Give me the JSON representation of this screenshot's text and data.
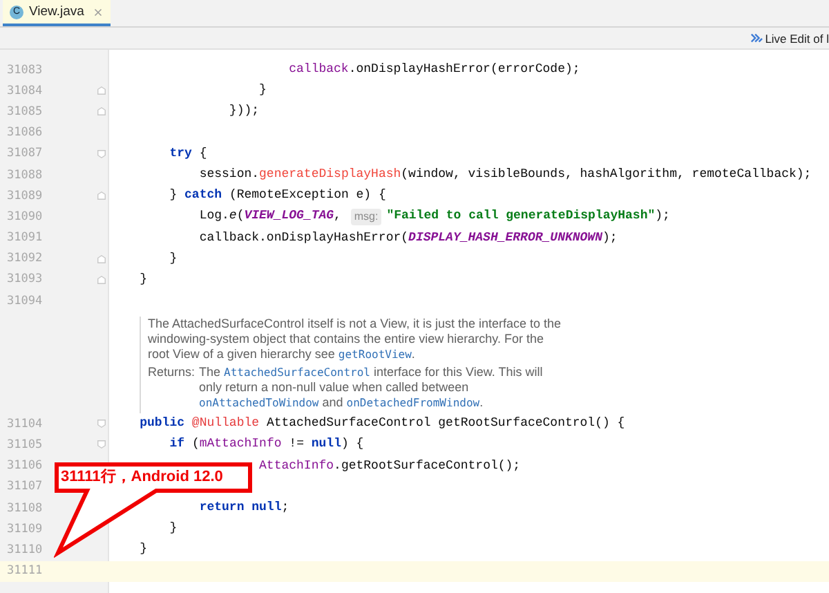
{
  "tab": {
    "badge": "C",
    "label": "View.java",
    "selected": true
  },
  "toolbar": {
    "live_edit": "Live Edit of l"
  },
  "lines": [
    {
      "number": "31083",
      "fold_start": false,
      "fold_end": false,
      "tokens": [
        {
          "kind": "field",
          "text": "                        callback"
        },
        {
          "kind": "plain",
          "text": ".onDisplayHashError(errorCode);"
        }
      ]
    },
    {
      "number": "31084",
      "fold_start": false,
      "fold_end": true,
      "tokens": [
        {
          "kind": "plain",
          "text": "                    }"
        }
      ]
    },
    {
      "number": "31085",
      "fold_start": false,
      "fold_end": true,
      "tokens": [
        {
          "kind": "plain",
          "text": "                }));"
        }
      ]
    },
    {
      "number": "31086",
      "fold_start": false,
      "fold_end": false
    },
    {
      "number": "31087",
      "fold_start": true,
      "fold_end": false,
      "tokens": [
        {
          "kind": "keyword",
          "text": "        try"
        },
        {
          "kind": "plain",
          "text": " {"
        }
      ]
    },
    {
      "number": "31088",
      "fold_start": false,
      "fold_end": false,
      "tokens": [
        {
          "kind": "plain",
          "text": "            session."
        },
        {
          "kind": "error",
          "text": "generateDisplayHash"
        },
        {
          "kind": "plain",
          "text": "(window, visibleBounds, hashAlgorithm, remoteCallback);"
        }
      ]
    },
    {
      "number": "31089",
      "fold_start": false,
      "fold_end": true,
      "tokens": [
        {
          "kind": "plain",
          "text": "        } "
        },
        {
          "kind": "keyword",
          "text": "catch"
        },
        {
          "kind": "plain",
          "text": " (RemoteException e) {"
        }
      ]
    },
    {
      "number": "31090",
      "fold_start": false,
      "fold_end": false,
      "tokens": [
        {
          "kind": "plain",
          "text": "            Log."
        },
        {
          "kind": "italic",
          "text": "e"
        },
        {
          "kind": "plain",
          "text": "("
        },
        {
          "kind": "constant",
          "text": "VIEW_LOG_TAG"
        },
        {
          "kind": "plain",
          "text": ", "
        },
        {
          "kind": "hint",
          "text": "msg:"
        },
        {
          "kind": "string",
          "text": "\"Failed to call generateDisplayHash\""
        },
        {
          "kind": "plain",
          "text": ");"
        }
      ]
    },
    {
      "number": "31091",
      "fold_start": false,
      "fold_end": false,
      "tokens": [
        {
          "kind": "plain",
          "text": "            callback.onDisplayHashError("
        },
        {
          "kind": "constant",
          "text": "DISPLAY_HASH_ERROR_UNKNOWN"
        },
        {
          "kind": "plain",
          "text": ");"
        }
      ]
    },
    {
      "number": "31092",
      "fold_start": false,
      "fold_end": true,
      "tokens": [
        {
          "kind": "plain",
          "text": "        }"
        }
      ]
    },
    {
      "number": "31093",
      "fold_start": false,
      "fold_end": true,
      "tokens": [
        {
          "kind": "plain",
          "text": "    }"
        }
      ]
    },
    {
      "number": "31094",
      "fold_start": false,
      "fold_end": false
    },
    {
      "kind": "doc",
      "description": [
        {
          "text": "The AttachedSurfaceControl itself is not a View, it is just the interface to the windowing-system object that contains the entire view hierarchy. For the root View of a given hierarchy see "
        },
        {
          "text": "getRootView",
          "link": true
        },
        {
          "text": "."
        }
      ],
      "returns_label": "Returns:",
      "returns": [
        {
          "text": "The "
        },
        {
          "text": "AttachedSurfaceControl",
          "link": true
        },
        {
          "text": " interface for this View. This will only return a non-null value when called between "
        },
        {
          "text": "onAttachedToWindow",
          "link": true
        },
        {
          "text": " and "
        },
        {
          "text": "onDetachedFromWindow",
          "link": true
        },
        {
          "text": "."
        }
      ]
    },
    {
      "number": "31104",
      "fold_start": true,
      "fold_end": false,
      "tokens": [
        {
          "kind": "keyword",
          "text": "    public"
        },
        {
          "kind": "annotation",
          "text": " @Nullable"
        },
        {
          "kind": "plain",
          "text": " AttachedSurfaceControl getRootSurfaceControl() {"
        }
      ]
    },
    {
      "number": "31105",
      "fold_start": true,
      "fold_end": false,
      "tokens": [
        {
          "kind": "keyword",
          "text": "        if"
        },
        {
          "kind": "plain",
          "text": " ("
        },
        {
          "kind": "field",
          "text": "mAttachInfo"
        },
        {
          "kind": "plain",
          "text": " != "
        },
        {
          "kind": "keyword",
          "text": "null"
        },
        {
          "kind": "plain",
          "text": ") {"
        }
      ]
    },
    {
      "number": "31106",
      "fold_start": false,
      "fold_end": false,
      "tokens": [
        {
          "kind": "field",
          "text": "                    AttachInfo"
        },
        {
          "kind": "plain",
          "text": ".getRootSurfaceControl();"
        }
      ]
    },
    {
      "number": "31107",
      "fold_start": false,
      "fold_end": false
    },
    {
      "number": "31108",
      "fold_start": false,
      "fold_end": false,
      "tokens": [
        {
          "kind": "keyword",
          "text": "            return"
        },
        {
          "kind": "keyword",
          "text": " null"
        },
        {
          "kind": "plain",
          "text": ";"
        }
      ]
    },
    {
      "number": "31109",
      "fold_start": false,
      "fold_end": false,
      "tokens": [
        {
          "kind": "plain",
          "text": "        }"
        }
      ]
    },
    {
      "number": "31110",
      "fold_start": false,
      "fold_end": false,
      "tokens": [
        {
          "kind": "plain",
          "text": "    }"
        }
      ]
    },
    {
      "number": "31111",
      "fold_start": false,
      "fold_end": false,
      "current": true
    }
  ],
  "callout": {
    "text": "31111行，Android 12.0"
  }
}
